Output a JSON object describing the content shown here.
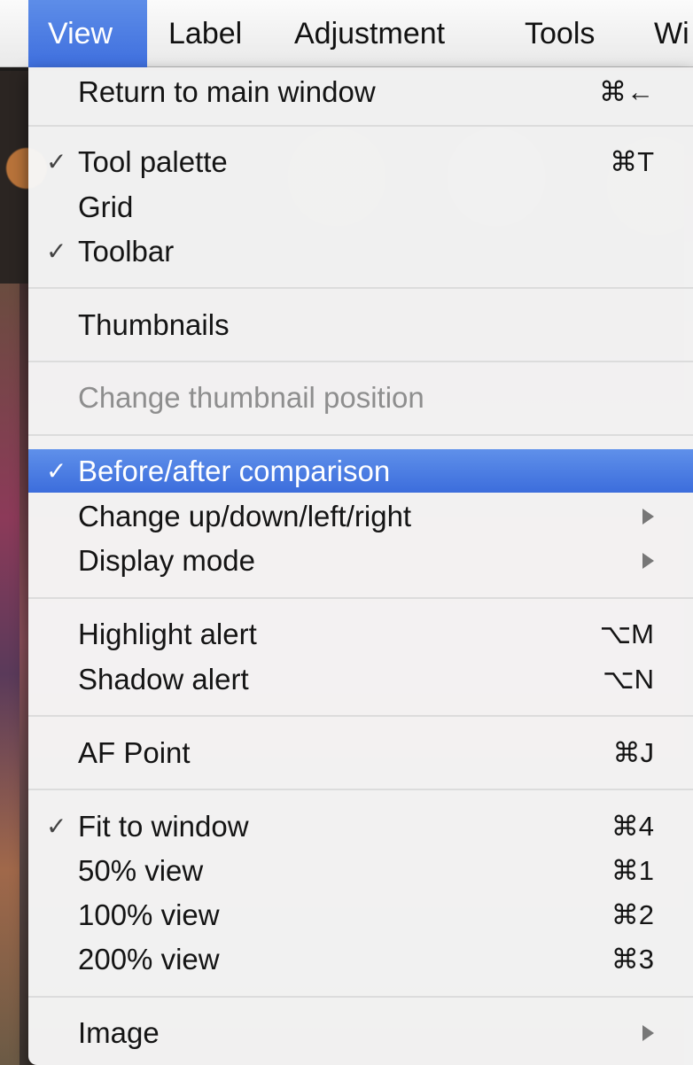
{
  "menubar": {
    "items": [
      {
        "label": "View",
        "active": true
      },
      {
        "label": "Label"
      },
      {
        "label": "Adjustment"
      },
      {
        "label": "Tools"
      },
      {
        "label": "Wi"
      }
    ]
  },
  "menu": {
    "items": [
      {
        "label": "Return to main window",
        "shortcut": "⌘←",
        "checked": false
      },
      {
        "label": "Tool palette",
        "shortcut": "⌘T",
        "checked": true
      },
      {
        "label": "Grid",
        "checked": false
      },
      {
        "label": "Toolbar",
        "checked": true
      },
      {
        "label": "Thumbnails",
        "checked": false
      },
      {
        "label": "Change thumbnail position",
        "disabled": true
      },
      {
        "label": "Before/after comparison",
        "checked": true,
        "highlighted": true
      },
      {
        "label": "Change up/down/left/right",
        "submenu": true
      },
      {
        "label": "Display mode",
        "submenu": true
      },
      {
        "label": "Highlight alert",
        "shortcut": "⌥M"
      },
      {
        "label": "Shadow alert",
        "shortcut": "⌥N"
      },
      {
        "label": "AF Point",
        "shortcut": "⌘J"
      },
      {
        "label": "Fit to window",
        "shortcut": "⌘4",
        "checked": true
      },
      {
        "label": "50% view",
        "shortcut": "⌘1"
      },
      {
        "label": "100% view",
        "shortcut": "⌘2"
      },
      {
        "label": "200% view",
        "shortcut": "⌘3"
      },
      {
        "label": "Image",
        "submenu": true
      }
    ],
    "check_glyph": "✓"
  },
  "colors": {
    "highlight": "#4a7be2",
    "menu_background": "#f7f7f7",
    "disabled_text": "#8e8e8e"
  }
}
